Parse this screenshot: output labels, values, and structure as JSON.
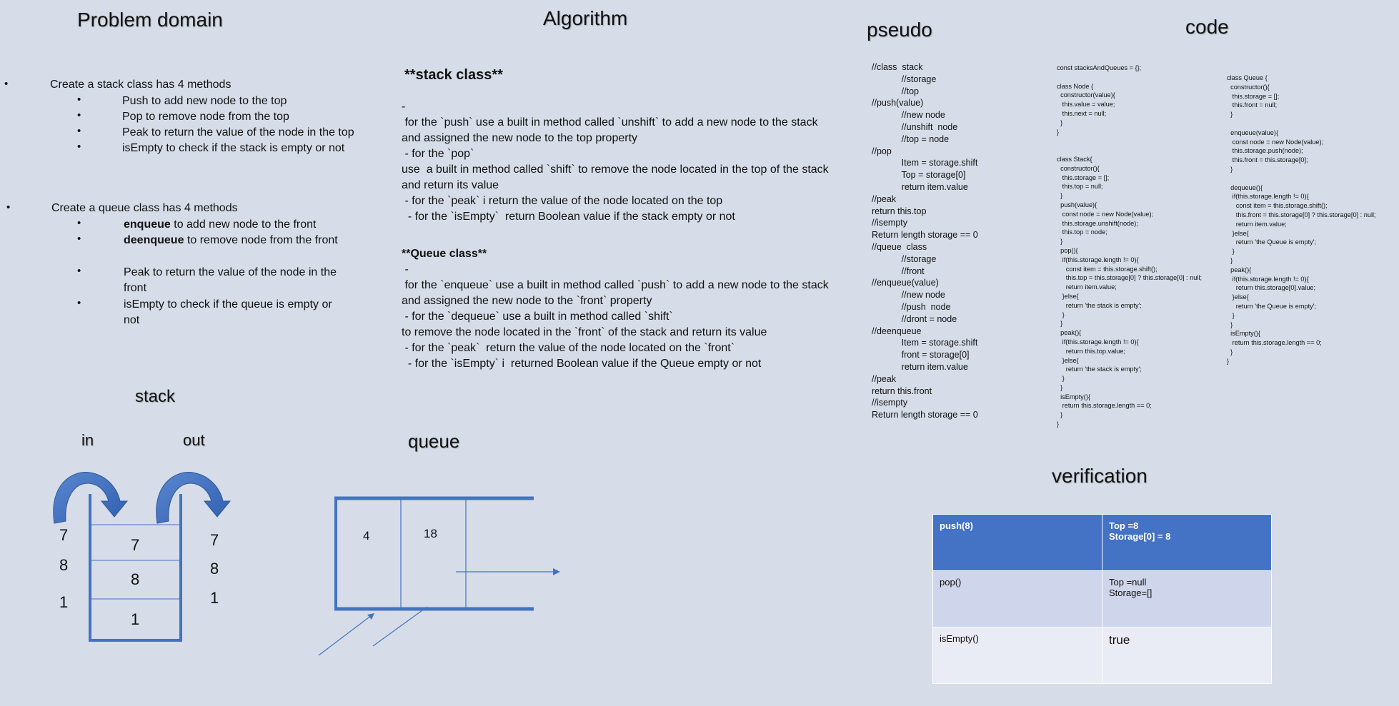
{
  "headings": {
    "problem_domain": "Problem domain",
    "algorithm": "Algorithm",
    "pseudo": "pseudo",
    "code": "code",
    "stack": "stack",
    "in": "in",
    "out": "out",
    "queue": "queue",
    "verification": "verification"
  },
  "problem_domain": {
    "stack_intro": "Create a stack class has 4 methods",
    "stack_items": [
      "Push to add new node to the top",
      "Pop to remove node from the top",
      "Peak to return the value of the node in the top",
      "isEmpty to check if the stack is empty or not"
    ],
    "queue_intro": "Create a queue class has 4 methods",
    "queue_items": [
      {
        "bold": "enqueue",
        "rest": " to add new node to the front"
      },
      {
        "bold": "deenqueue",
        "rest": " to remove node from the front"
      },
      {
        "bold": "",
        "rest": "Peak to return the value of the node in the front"
      },
      {
        "bold": "",
        "rest": "isEmpty to check if the queue is empty or not"
      }
    ]
  },
  "algorithm": {
    "stack_title": "**stack class**",
    "stack_lines": [
      "-",
      " for the `push` use a built in method called `unshift` to add a new node to the stack and assigned the new node to the top property",
      " - for the `pop`",
      "use  a built in method called `shift` to remove the node located in the top of the stack and return its value",
      " - for the `peak` i return the value of the node located on the top",
      "  - for the `isEmpty`  return Boolean value if the stack empty or not"
    ],
    "queue_title": "**Queue class**",
    "queue_lines": [
      " -",
      " for the `enqueue` use a built in method called `push` to add a new node to the stack and assigned the new node to the `front` property",
      " - for the `dequeue` use a built in method called `shift`",
      "to remove the node located in the `front` of the stack and return its value",
      " - for the `peak`  return the value of the node located on the `front`",
      "  - for the `isEmpty` i  returned Boolean value if the Queue empty or not"
    ]
  },
  "pseudo_lines": [
    "//class  stack",
    "            //storage",
    "            //top",
    "//push(value)",
    "            //new node",
    "            //unshift  node",
    "            //top = node",
    "//pop",
    "            Item = storage.shift",
    "            Top = storage[0]",
    "            return item.value",
    "//peak",
    "return this.top",
    "//isempty",
    "Return length storage == 0",
    "//queue  class",
    "            //storage",
    "            //front",
    "//enqueue(value)",
    "            //new node",
    "            //push  node",
    "            //dront = node",
    "//deenqueue",
    "            Item = storage.shift",
    "            front = storage[0]",
    "            return item.value",
    "//peak",
    "return this.front",
    "//isempty",
    "Return length storage == 0"
  ],
  "code_col1": [
    "const stacksAndQueues = {};",
    "",
    "class Node {",
    "  constructor(value){",
    "   this.value = value;",
    "   this.next = null;",
    "  }",
    "}",
    "",
    "",
    "class Stack{",
    "  constructor(){",
    "   this.storage = [];",
    "   this.top = null;",
    "  }",
    "  push(value){",
    "   const node = new Node(value);",
    "   this.storage.unshift(node);",
    "   this.top = node;",
    "  }",
    "  pop(){",
    "   if(this.storage.length != 0){",
    "     const item = this.storage.shift();",
    "     this.top = this.storage[0] ? this.storage[0] : null;",
    "     return item.value;",
    "   }else{",
    "     return 'the stack is empty';",
    "   }",
    "  }",
    "  peak(){",
    "   if(this.storage.length != 0){",
    "     return this.top.value;",
    "   }else{",
    "     return 'the stack is empty';",
    "   }",
    "  }",
    "  isEmpty(){",
    "   return this.storage.length == 0;",
    "  }",
    "}"
  ],
  "code_col2": [
    "class Queue {",
    "  constructor(){",
    "   this.storage = [];",
    "   this.front = null;",
    "  }",
    "",
    "  enqueue(value){",
    "   const node = new Node(value);",
    "   this.storage.push(node);",
    "   this.front = this.storage[0];",
    "  }",
    "",
    "  dequeue(){",
    "   if(this.storage.length != 0){",
    "     const item = this.storage.shift();",
    "     this.front = this.storage[0] ? this.storage[0] : null;",
    "     return item.value;",
    "   }else{",
    "     return 'the Queue is empty';",
    "   }",
    "  }",
    "  peak(){",
    "   if(this.storage.length != 0){",
    "     return this.storage[0].value;",
    "   }else{",
    "     return 'the Queue is empty';",
    "   }",
    "  }",
    "  isEmpty(){",
    "   return this.storage.length == 0;",
    "  }",
    "}"
  ],
  "stack_diagram": {
    "in_values": [
      "7",
      "8",
      "1"
    ],
    "cells": [
      "7",
      "8",
      "1"
    ],
    "out_values": [
      "7",
      "8",
      "1"
    ]
  },
  "queue_diagram": {
    "cells": [
      "4",
      "18"
    ]
  },
  "verification": {
    "rows": [
      {
        "action": "push(8)",
        "result_1": "Top =8",
        "result_2": "Storage[0] = 8"
      },
      {
        "action": "pop()",
        "result_1": "Top =null",
        "result_2": "Storage=[]"
      },
      {
        "action": "isEmpty()",
        "result_1": "true",
        "result_2": ""
      }
    ]
  },
  "colors": {
    "background": "#d6dde8",
    "accent": "#4472c4",
    "row_light": "#cfd5ea",
    "row_lighter": "#e9ebf5"
  }
}
